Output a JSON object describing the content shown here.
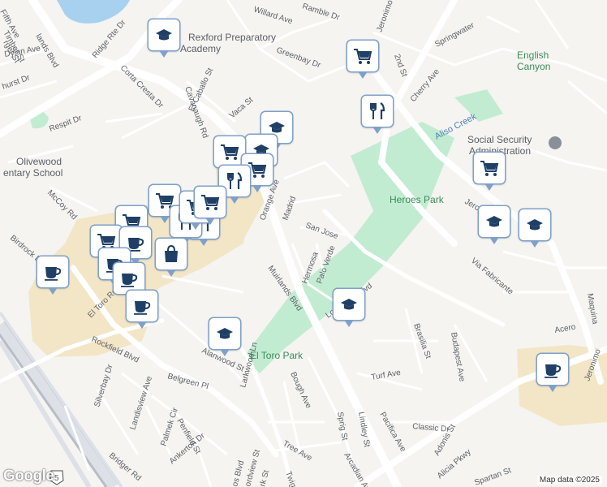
{
  "map": {
    "attribution": "Map data ©2025",
    "logo": "Google",
    "areas": {
      "heroes_park": "Heroes Park",
      "el_toro_park": "El Toro Park",
      "english_canyon": "English Canyon",
      "aliso_creek": "Aliso Creek"
    },
    "places": {
      "school_top": "Rexford Preparatory Academy",
      "school_left": "Olivewood Elementary School",
      "ssa": "Social Security Administration"
    },
    "streets": [
      {
        "key": "willard",
        "text": "Willard Ave"
      },
      {
        "key": "ramble",
        "text": "Ramble Dr"
      },
      {
        "key": "greenbay",
        "text": "Greenbay Dr"
      },
      {
        "key": "springwater",
        "text": "Springwater"
      },
      {
        "key": "second",
        "text": "2nd St"
      },
      {
        "key": "cherry",
        "text": "Cherry Ave"
      },
      {
        "key": "ridge",
        "text": "Ridge Rte Dr"
      },
      {
        "key": "corta",
        "text": "Corta Cresta Dr"
      },
      {
        "key": "cavanaugh",
        "text": "Cavanaugh Rd"
      },
      {
        "key": "caballo",
        "text": "El Caballo St"
      },
      {
        "key": "vaca",
        "text": "Vaca St"
      },
      {
        "key": "dylan",
        "text": "Dylan Ave"
      },
      {
        "key": "hurst",
        "text": "hurst Dr"
      },
      {
        "key": "respit",
        "text": "Respit Dr"
      },
      {
        "key": "mccoy",
        "text": "McCoy Rd"
      },
      {
        "key": "birdrock",
        "text": "Birdrock Dr"
      },
      {
        "key": "orange",
        "text": "Orange Ave"
      },
      {
        "key": "madrid",
        "text": "Madrid"
      },
      {
        "key": "sanjose",
        "text": "San Jose"
      },
      {
        "key": "hermosa",
        "text": "Hermosa"
      },
      {
        "key": "paloverde",
        "text": "Palo Verde"
      },
      {
        "key": "muirlands",
        "text": "Muirlands Blvd"
      },
      {
        "key": "eltoro",
        "text": "El Toro Rd"
      },
      {
        "key": "rockfield",
        "text": "Rockfield Blvd"
      },
      {
        "key": "belgreen",
        "text": "Belgreen Pl"
      },
      {
        "key": "alanwood",
        "text": "Alanwood St"
      },
      {
        "key": "larkwood",
        "text": "Larkwood Ln"
      },
      {
        "key": "bough",
        "text": "Bough Ave"
      },
      {
        "key": "silverbay",
        "text": "Silverbay Dr"
      },
      {
        "key": "landisview",
        "text": "Landisview Ave"
      },
      {
        "key": "penfield",
        "text": "Penfield St"
      },
      {
        "key": "palmek",
        "text": "Palmek Cir"
      },
      {
        "key": "ankerton",
        "text": "Ankerton Dr"
      },
      {
        "key": "bridger",
        "text": "Bridger Rd"
      },
      {
        "key": "tree",
        "text": "Tree Ave"
      },
      {
        "key": "twig",
        "text": "Twig St"
      },
      {
        "key": "arcadian",
        "text": "Arcadian Ave"
      },
      {
        "key": "lindley",
        "text": "Lindley St"
      },
      {
        "key": "sprig",
        "text": "Sprig St"
      },
      {
        "key": "turf",
        "text": "Turf Ave"
      },
      {
        "key": "brasilia",
        "text": "Brasilia St"
      },
      {
        "key": "budapest",
        "text": "Budapest Ave"
      },
      {
        "key": "classic",
        "text": "Classic Dr"
      },
      {
        "key": "adonis",
        "text": "Adonis St"
      },
      {
        "key": "pacifica",
        "text": "Pacifica Ave"
      },
      {
        "key": "alicia",
        "text": "Alicia Pkwy"
      },
      {
        "key": "spartan",
        "text": "Spartan St"
      },
      {
        "key": "fabricante",
        "text": "Via Fabricante"
      },
      {
        "key": "acero",
        "text": "Acero"
      },
      {
        "key": "maquina",
        "text": "Maquina"
      },
      {
        "key": "lospatrones",
        "text": "Los Alisos Blvd"
      },
      {
        "key": "jeronimo_top",
        "text": "Jeronimo Rd"
      },
      {
        "key": "jeronimo_mid",
        "text": "Jeronimo Rd"
      },
      {
        "key": "jeronimo_br",
        "text": "Jeronimo"
      },
      {
        "key": "rockdale",
        "text": "os Blvd"
      },
      {
        "key": "ordview",
        "text": "ordview St"
      },
      {
        "key": "rkst",
        "text": "rk St"
      },
      {
        "key": "fifth",
        "text": "Fifth Ave"
      },
      {
        "key": "fifth_timber",
        "text": "Timber St"
      },
      {
        "key": "ladslvd",
        "text": "lands Blvd"
      },
      {
        "key": "geger",
        "text": "rger St"
      },
      {
        "key": "entary",
        "text": "entary School"
      },
      {
        "key": "route5",
        "text": "5"
      }
    ],
    "markers": [
      {
        "icon": "school-icon"
      },
      {
        "icon": "shopping-cart-icon"
      },
      {
        "icon": "restaurant-icon"
      },
      {
        "icon": "school-icon"
      },
      {
        "icon": "school-icon"
      },
      {
        "icon": "shopping-cart-icon"
      },
      {
        "icon": "shopping-cart-icon"
      },
      {
        "icon": "restaurant-icon"
      },
      {
        "icon": "shopping-cart-icon"
      },
      {
        "icon": "shopping-cart-icon"
      },
      {
        "icon": "shopping-cart-icon"
      },
      {
        "icon": "restaurant-icon"
      },
      {
        "icon": "restaurant-icon"
      },
      {
        "icon": "shopping-cart-icon"
      },
      {
        "icon": "shopping-cart-icon"
      },
      {
        "icon": "coffee-icon"
      },
      {
        "icon": "shopping-bag-icon"
      },
      {
        "icon": "coffee-icon"
      },
      {
        "icon": "coffee-icon"
      },
      {
        "icon": "coffee-icon"
      },
      {
        "icon": "coffee-icon"
      },
      {
        "icon": "school-icon"
      },
      {
        "icon": "school-icon"
      },
      {
        "icon": "shopping-cart-icon"
      },
      {
        "icon": "school-icon"
      },
      {
        "icon": "school-icon"
      },
      {
        "icon": "coffee-icon"
      }
    ],
    "colors": {
      "background": "#f5f4f1",
      "park": "#c2ecd1",
      "commercial": "#f3e6c6",
      "water": "#a8d1f0",
      "road": "#ffffff",
      "highway": "#c9ced6",
      "marker_border": "#7fa0c8",
      "icon": "#1f3f66"
    }
  }
}
